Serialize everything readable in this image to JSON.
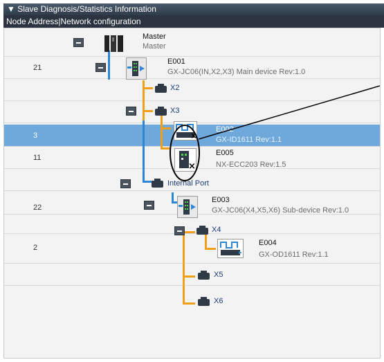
{
  "window": {
    "title": "▼ Slave Diagnosis/Statistics Information"
  },
  "columns": {
    "header": "Node Address|Network configuration"
  },
  "master": {
    "name": "Master",
    "sub": "Master"
  },
  "rows": [
    {
      "address": "21"
    },
    {
      "address": ""
    },
    {
      "address": ""
    },
    {
      "address": "3"
    },
    {
      "address": "11"
    },
    {
      "address": ""
    },
    {
      "address": "22"
    },
    {
      "address": ""
    },
    {
      "address": "2"
    },
    {
      "address": ""
    },
    {
      "address": ""
    }
  ],
  "devices": {
    "e001": {
      "id": "E001",
      "desc": "GX-JC06(IN,X2,X3) Main device Rev:1.0"
    },
    "e002": {
      "id": "E002",
      "desc": "GX-ID1611 Rev:1.1"
    },
    "e005": {
      "id": "E005",
      "desc": "NX-ECC203 Rev:1.5"
    },
    "e003": {
      "id": "E003",
      "desc": "GX-JC06(X4,X5,X6) Sub-device Rev:1.0"
    },
    "e004": {
      "id": "E004",
      "desc": "GX-OD1611 Rev:1.1"
    }
  },
  "ports": {
    "x2": "X2",
    "x3": "X3",
    "internal": "Internal Port",
    "x4": "X4",
    "x5": "X5",
    "x6": "X6"
  },
  "colors": {
    "selected_row": "#6fa9dc",
    "ethercat_line": "#2d86d4",
    "port_line": "#f0a018",
    "header": "#2b3440"
  }
}
